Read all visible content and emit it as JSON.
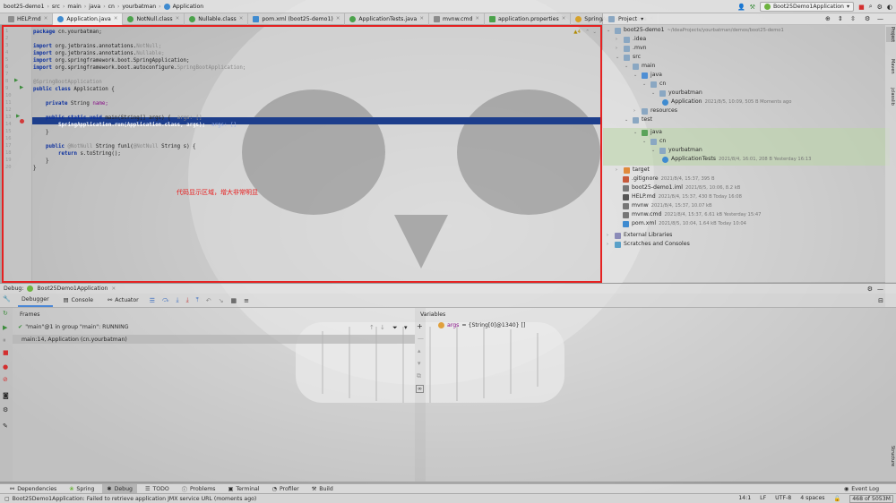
{
  "breadcrumbs": [
    "boot25-demo1",
    "src",
    "main",
    "java",
    "cn",
    "yourbatman",
    "Application"
  ],
  "run_config": "Boot25Demo1Application",
  "tabs": [
    {
      "label": "HELP.md",
      "color": "#8c8c8c"
    },
    {
      "label": "Application.java",
      "color": "#3f8bd0",
      "active": true
    },
    {
      "label": "NotNull.class",
      "color": "#4ba24b"
    },
    {
      "label": "Nullable.class",
      "color": "#4ba24b"
    },
    {
      "label": "pom.xml (boot25-demo1)",
      "color": "#3f8bd0"
    },
    {
      "label": "ApplicationTests.java",
      "color": "#4ba24b"
    },
    {
      "label": "mvnw.cmd",
      "color": "#8c8c8c"
    },
    {
      "label": "application.properties",
      "color": "#4ba24b"
    },
    {
      "label": "SpringApplication.java",
      "color": "#d6a22a"
    }
  ],
  "editor": {
    "warnings": "▲4",
    "lines": [
      "1",
      "2",
      "3",
      "4",
      "5",
      "6",
      "7",
      "8",
      "9",
      "10",
      "11",
      "12",
      "13",
      "14",
      "15",
      "16",
      "17",
      "18",
      "19",
      "20"
    ],
    "code": {
      "l1_kw": "package",
      "l1_rest": " cn.yourbatman;",
      "l3_kw": "import",
      "l3_rest": " org.jetbrains.annotations.",
      "l3_dim": "NotNull;",
      "l4_kw": "import",
      "l4_rest": " org.jetbrains.annotations.",
      "l4_dim": "Nullable;",
      "l5_kw": "import",
      "l5_rest": " org.springframework.boot.SpringApplication;",
      "l6_kw": "import",
      "l6_rest": " org.springframework.boot.autoconfigure.",
      "l6_dim": "SpringBootApplication;",
      "l8_ann": "@SpringBootApplication",
      "l9_kw": "public class",
      "l9_rest": " Application {",
      "l11_kw": "private",
      "l11_rest": " String ",
      "l11_fld": "name;",
      "l13_kw": "public static void",
      "l13_rest": " main(String[] args) {",
      "l13_dim": "  args: []",
      "l14_code": "SpringApplication.run(Application.class, args);",
      "l14_dim": "  args: []",
      "l15_rest": "}",
      "l17_kw": "public",
      "l17_ann": " @NotNull",
      "l17_rest": " String fun1(",
      "l17_ann2": "@NotNull",
      "l17_rest2": " String s) {",
      "l18_kw": "return",
      "l18_rest": " s.toString();",
      "l19_rest": "}",
      "l20_rest": "}"
    },
    "note": "代码显示区域，增大非常明显"
  },
  "project": {
    "header": "Project",
    "items": [
      {
        "label": "boot25-demo1",
        "meta": "~/IdeaProjects/yourbatman/demos/boot25-demo1"
      },
      {
        "label": ".idea",
        "meta": ""
      },
      {
        "label": ".mvn",
        "meta": ""
      },
      {
        "label": "src",
        "meta": ""
      },
      {
        "label": "main",
        "meta": ""
      },
      {
        "label": "java",
        "meta": ""
      },
      {
        "label": "cn",
        "meta": ""
      },
      {
        "label": "yourbatman",
        "meta": ""
      },
      {
        "label": "Application",
        "meta": "2021/8/5, 10:09, 505 B Moments ago"
      },
      {
        "label": "resources",
        "meta": ""
      },
      {
        "label": "test",
        "meta": ""
      },
      {
        "label": "java",
        "meta": ""
      },
      {
        "label": "cn",
        "meta": ""
      },
      {
        "label": "yourbatman",
        "meta": ""
      },
      {
        "label": "ApplicationTests",
        "meta": "2021/8/4, 16:01, 208 B Yesterday 16:13"
      },
      {
        "label": "target",
        "meta": ""
      },
      {
        "label": ".gitignore",
        "meta": "2021/8/4, 15:37, 395 B"
      },
      {
        "label": "boot25-demo1.iml",
        "meta": "2021/8/5, 10:06, 8.2 kB"
      },
      {
        "label": "HELP.md",
        "meta": "2021/8/4, 15:37, 430 B Today 16:08"
      },
      {
        "label": "mvnw",
        "meta": "2021/8/4, 15:37, 10.07 kB"
      },
      {
        "label": "mvnw.cmd",
        "meta": "2021/8/4, 15:37, 6.61 kB Yesterday 15:47"
      },
      {
        "label": "pom.xml",
        "meta": "2021/8/5, 10:04, 1.64 kB Today 10:04"
      },
      {
        "label": "External Libraries",
        "meta": ""
      },
      {
        "label": "Scratches and Consoles",
        "meta": ""
      }
    ]
  },
  "right_strip": [
    "Project",
    "Maven",
    "jclasslib",
    "Structure"
  ],
  "debug": {
    "title": "Debug:",
    "config": "Boot25Demo1Application",
    "tabs": [
      "Debugger",
      "Console",
      "Actuator"
    ],
    "frames_label": "Frames",
    "thread": "\"main\"@1 in group \"main\": RUNNING",
    "frame": "main:14, Application (cn.yourbatman)",
    "variables_label": "Variables",
    "var_name": "args",
    "var_value": " = {String[0]@1340} []"
  },
  "bottom_tabs": [
    "Dependencies",
    "Spring",
    "Debug",
    "TODO",
    "Problems",
    "Terminal",
    "Profiler",
    "Build"
  ],
  "status": {
    "message": "Boot25Demo1Application: Failed to retrieve application JMX service URL (moments ago)",
    "position": "14:1",
    "line_sep": "LF",
    "encoding": "UTF-8",
    "indent": "4 spaces",
    "memory": "468 of 5053M",
    "event_log": "Event Log"
  },
  "colors": {
    "accent": "#4a87d6",
    "highlight": "#1d3e8c",
    "border_red": "#e52222"
  }
}
